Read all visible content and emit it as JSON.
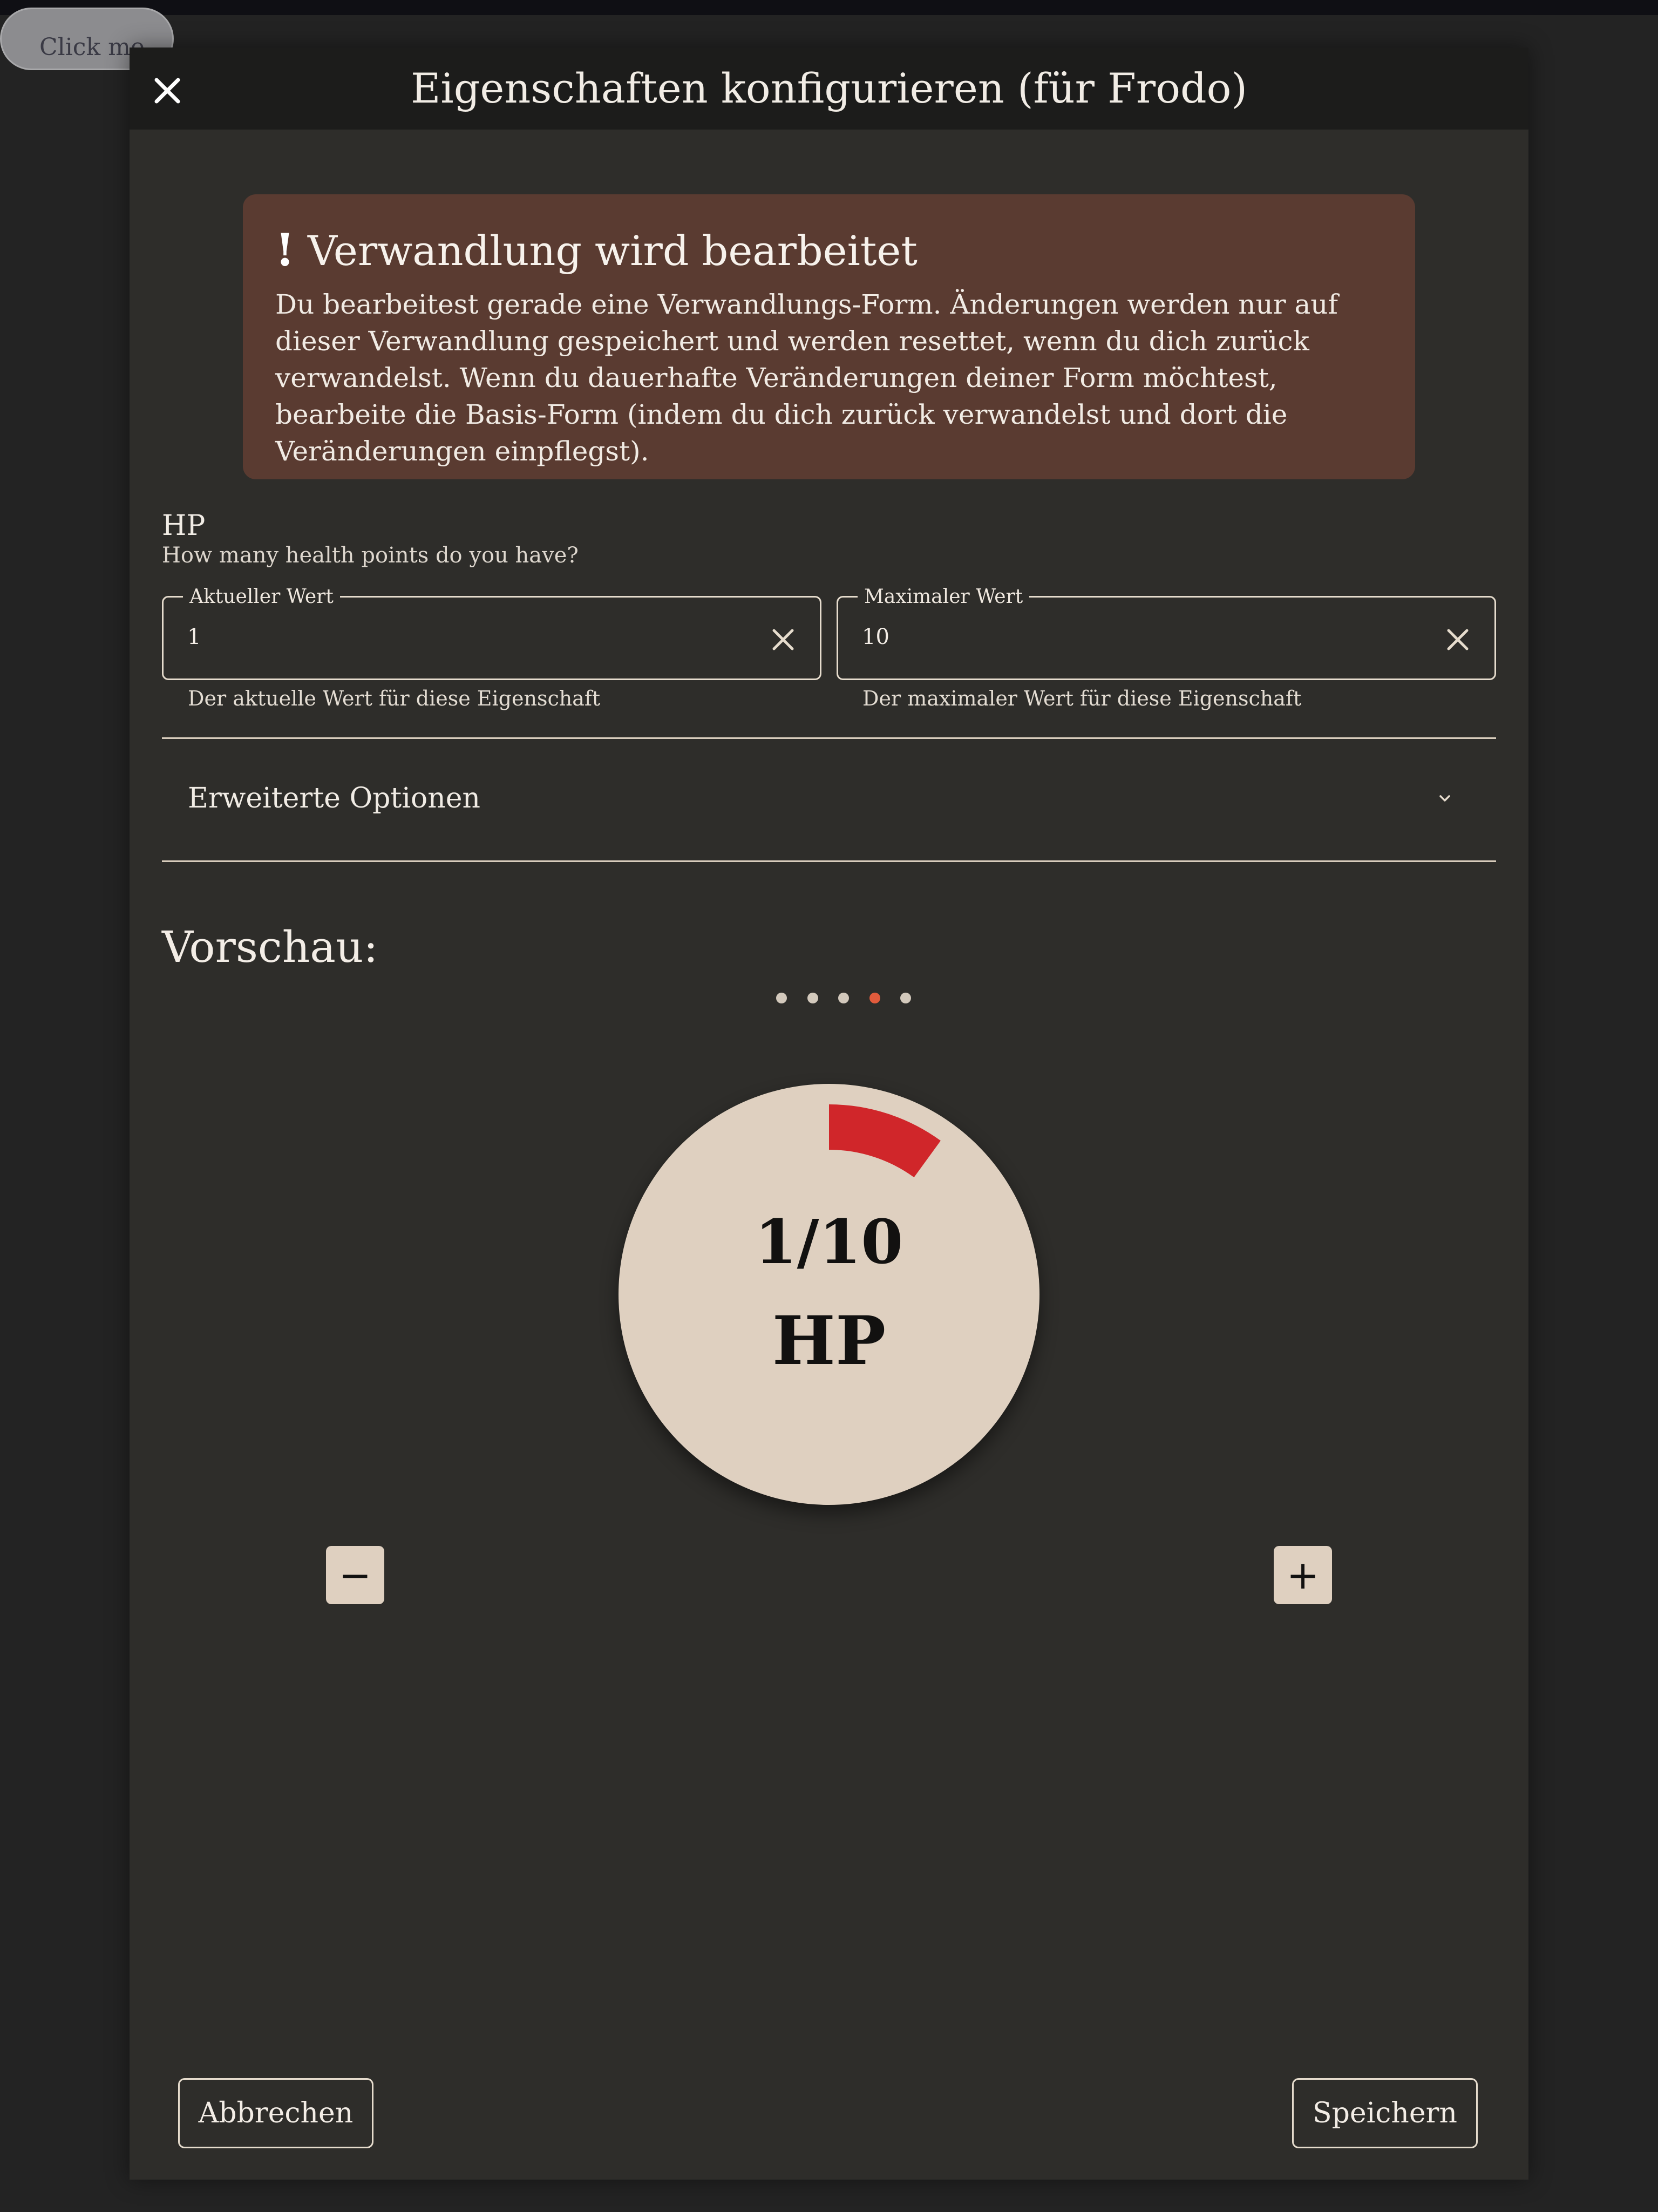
{
  "background_button": {
    "label": "Click me"
  },
  "dialog": {
    "title": "Eigenschaften konfigurieren (für Frodo)"
  },
  "warning": {
    "icon": "!",
    "title": "Verwandlung wird bearbeitet",
    "text": "Du bearbeitest gerade eine Verwandlungs-Form. Änderungen werden nur auf dieser Verwandlung gespeichert und werden resettet, wenn du dich zurück verwandelst. Wenn du dauerhafte Veränderungen deiner Form möchtest, bearbeite die Basis-Form (indem du dich zurück verwandelst und dort die Veränderungen einpflegst)."
  },
  "property": {
    "name": "HP",
    "description": "How many health points do you have?"
  },
  "fields": {
    "current": {
      "label": "Aktueller Wert",
      "value": "1",
      "helper": "Der aktuelle Wert für diese Eigenschaft"
    },
    "max": {
      "label": "Maximaler Wert",
      "value": "10",
      "helper": "Der maximaler Wert für diese Eigenschaft"
    }
  },
  "advanced": {
    "label": "Erweiterte Optionen"
  },
  "preview": {
    "label": "Vorschau:",
    "carousel_count": 5,
    "carousel_active_index": 3,
    "gauge_value_text": "1/10",
    "gauge_unit": "HP",
    "current": 1,
    "max": 10,
    "arc_color": "#d0262a",
    "minus_label": "−",
    "plus_label": "+"
  },
  "footer": {
    "cancel_label": "Abbrechen",
    "save_label": "Speichern"
  },
  "colors": {
    "dialog_bg": "#2e2d2a",
    "header_bg": "#1c1c1b",
    "warning_bg": "#5a3b31",
    "accent_dot": "#e15b3c",
    "gauge_bg": "#dfd0c0"
  },
  "icons": {
    "close": "close-icon",
    "clear": "clear-icon",
    "chevron": "chevron-down-icon"
  }
}
